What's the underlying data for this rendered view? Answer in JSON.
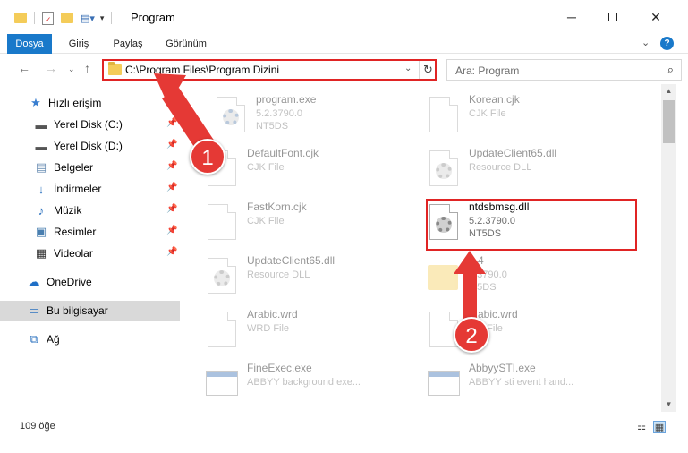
{
  "window": {
    "title": "Program"
  },
  "ribbon": {
    "tabs": [
      "Dosya",
      "Giriş",
      "Paylaş",
      "Görünüm"
    ]
  },
  "address": {
    "path": "C:\\Program Files\\Program Dizini"
  },
  "search": {
    "placeholder": "Ara: Program"
  },
  "sidebar": {
    "items": [
      {
        "label": "Hızlı erişim",
        "icon": "star-icon"
      },
      {
        "label": "Yerel Disk (C:)",
        "icon": "drive-icon",
        "pinned": true
      },
      {
        "label": "Yerel Disk (D:)",
        "icon": "drive-icon",
        "pinned": true
      },
      {
        "label": "Belgeler",
        "icon": "documents-icon",
        "pinned": true
      },
      {
        "label": "İndirmeler",
        "icon": "download-icon",
        "pinned": true
      },
      {
        "label": "Müzik",
        "icon": "music-icon",
        "pinned": true
      },
      {
        "label": "Resimler",
        "icon": "pictures-icon",
        "pinned": true
      },
      {
        "label": "Videolar",
        "icon": "videos-icon",
        "pinned": true
      },
      {
        "label": "OneDrive",
        "icon": "cloud-icon"
      },
      {
        "label": "Bu bilgisayar",
        "icon": "computer-icon",
        "selected": true
      },
      {
        "label": "Ağ",
        "icon": "network-icon"
      }
    ]
  },
  "files": [
    {
      "name": "program.exe",
      "line2": "5.2.3790.0",
      "line3": "NT5DS",
      "kind": "exe"
    },
    {
      "name": "Korean.cjk",
      "line2": "CJK File",
      "line3": "",
      "kind": "doc"
    },
    {
      "name": "DefaultFont.cjk",
      "line2": "CJK File",
      "line3": "",
      "kind": "doc"
    },
    {
      "name": "UpdateClient65.dll",
      "line2": "Resource DLL",
      "line3": "",
      "kind": "dll"
    },
    {
      "name": "FastKorn.cjk",
      "line2": "CJK File",
      "line3": "",
      "kind": "doc"
    },
    {
      "name": "ntdsbmsg.dll",
      "line2": "5.2.3790.0",
      "line3": "NT5DS",
      "kind": "dll",
      "highlighted": true
    },
    {
      "name": "UpdateClient65.dll",
      "line2": "Resource DLL",
      "line3": "",
      "kind": "dll"
    },
    {
      "name": "...4",
      "line2": "...3790.0",
      "line3": "...5DS",
      "kind": "folder"
    },
    {
      "name": "Arabic.wrd",
      "line2": "WRD File",
      "line3": "",
      "kind": "doc"
    },
    {
      "name": "...abic.wrd",
      "line2": "...D File",
      "line3": "",
      "kind": "doc"
    },
    {
      "name": "FineExec.exe",
      "line2": "ABBYY background exe...",
      "line3": "",
      "kind": "exebox"
    },
    {
      "name": "AbbyySTI.exe",
      "line2": "ABBYY sti event hand...",
      "line3": "",
      "kind": "exebox"
    }
  ],
  "status": {
    "count": "109 öğe"
  },
  "callouts": [
    "1",
    "2"
  ],
  "colors": {
    "accent": "#1979ca",
    "annotation": "#e53935"
  }
}
